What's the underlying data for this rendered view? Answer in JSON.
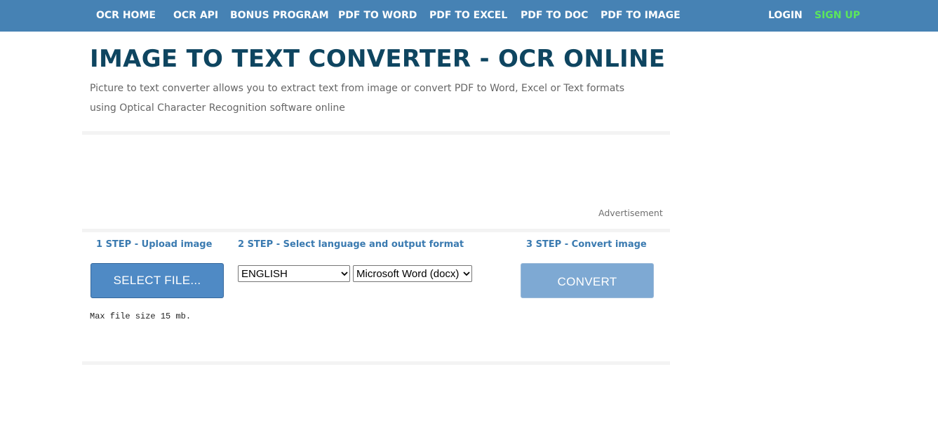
{
  "nav": {
    "items": [
      {
        "label": "OCR HOME"
      },
      {
        "label": "OCR API"
      },
      {
        "label": "BONUS PROGRAM"
      },
      {
        "label": "PDF TO WORD"
      },
      {
        "label": "PDF TO EXCEL"
      },
      {
        "label": "PDF TO DOC"
      },
      {
        "label": "PDF TO IMAGE"
      }
    ],
    "login": "LOGIN",
    "signup": "SIGN UP"
  },
  "header": {
    "title": "IMAGE TO TEXT CONVERTER - OCR ONLINE",
    "subtitle": "Picture to text converter allows you to extract text from image or convert PDF to Word, Excel or Text formats using Optical Character Recognition software online"
  },
  "ad": {
    "label": "Advertisement"
  },
  "steps": {
    "step1": "1 STEP - Upload image",
    "step2": "2 STEP - Select language and output format",
    "step3": "3 STEP - Convert image"
  },
  "upload": {
    "button_label": "SELECT FILE...",
    "max_size": "Max file size 15 mb."
  },
  "options": {
    "language": "ENGLISH",
    "format": "Microsoft Word (docx)"
  },
  "convert": {
    "button_label": "CONVERT"
  },
  "colors": {
    "navbar": "#4682b4",
    "title": "#0e4560",
    "signup": "#5ce65c",
    "step_text": "#3a7ab0",
    "select_button": "#4f8ac5",
    "convert_button": "#7ea9d3"
  }
}
